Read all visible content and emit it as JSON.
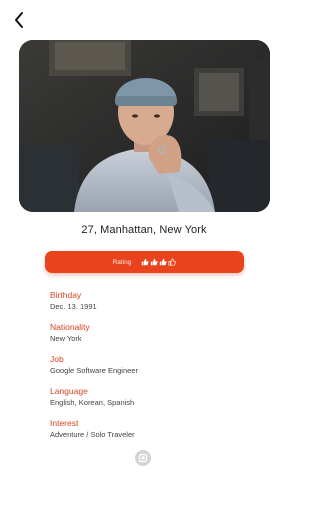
{
  "nav": {
    "back_icon": "chevron-left-icon"
  },
  "profile": {
    "photo_alt": "profile-photo",
    "headline": "27, Manhattan, New York"
  },
  "rating": {
    "label": "Rating",
    "icon": "thumbs-up-icon",
    "filled": 3,
    "total": 4,
    "accent_color": "#e8431c"
  },
  "details": {
    "label_color": "#d9451c",
    "fields": [
      {
        "label": "Birthday",
        "value": "Dec. 13. 1991"
      },
      {
        "label": "Nationality",
        "value": "New York"
      },
      {
        "label": "Job",
        "value": "Google Software Engineer"
      },
      {
        "label": "Language",
        "value": "English, Korean, Spanish"
      },
      {
        "label": "Interest",
        "value": "Adventure / Solo Traveler"
      }
    ]
  },
  "footer": {
    "icon": "app-logo-icon"
  }
}
